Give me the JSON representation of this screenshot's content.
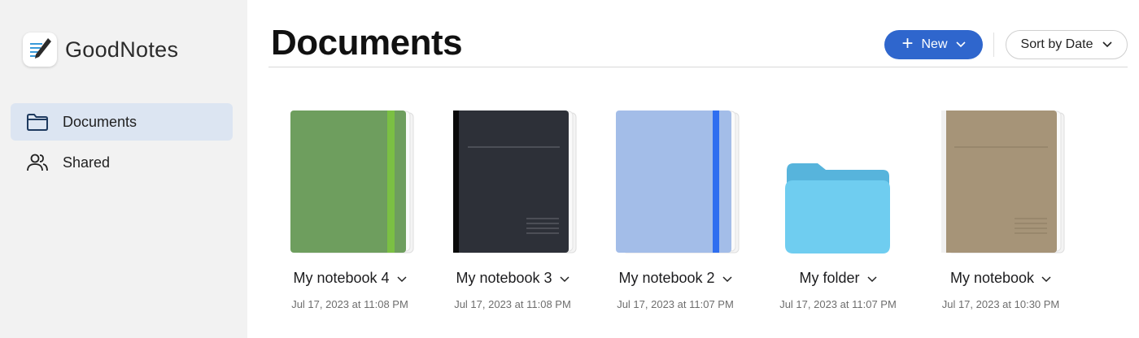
{
  "app": {
    "name": "GoodNotes"
  },
  "sidebar": {
    "items": [
      {
        "label": "Documents",
        "active": true,
        "icon": "folder-icon"
      },
      {
        "label": "Shared",
        "active": false,
        "icon": "people-icon"
      }
    ]
  },
  "header": {
    "title": "Documents",
    "new_label": "New",
    "sort_label": "Sort by Date"
  },
  "documents": [
    {
      "name": "My notebook 4",
      "date": "Jul 17, 2023 at 11:08 PM",
      "type": "notebook",
      "cover": "green",
      "color": "#6e9e5e",
      "accent": "#7bc043"
    },
    {
      "name": "My notebook 3",
      "date": "Jul 17, 2023 at 11:08 PM",
      "type": "notebook",
      "cover": "dark",
      "color": "#2d3038",
      "accent": "#0a0a0a"
    },
    {
      "name": "My notebook 2",
      "date": "Jul 17, 2023 at 11:07 PM",
      "type": "notebook",
      "cover": "light-blue",
      "color": "#a3bde8",
      "accent": "#2f6ef0"
    },
    {
      "name": "My folder",
      "date": "Jul 17, 2023 at 11:07 PM",
      "type": "folder",
      "color": "#6fcdf0"
    },
    {
      "name": "My notebook",
      "date": "Jul 17, 2023 at 10:30 PM",
      "type": "notebook",
      "cover": "tan",
      "color": "#a69478",
      "accent": "#f1f1f1"
    }
  ],
  "colors": {
    "accent": "#2f66cd",
    "sidebar_bg": "#f2f2f2",
    "active_bg": "#dce5f2"
  }
}
